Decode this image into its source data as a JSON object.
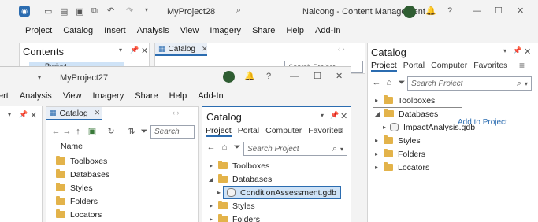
{
  "back_window": {
    "title": "MyProject28",
    "app_title": "Naicong - Content Management",
    "menu": [
      "Project",
      "Catalog",
      "Insert",
      "Analysis",
      "View",
      "Imagery",
      "Share",
      "Help",
      "Add-In"
    ],
    "contents_title": "Contents",
    "contents_item": "Project",
    "catalog_tab": "Catalog",
    "search_placeholder": "Search Project"
  },
  "front_window": {
    "title": "MyProject27",
    "menu": [
      "ert",
      "Analysis",
      "View",
      "Imagery",
      "Share",
      "Help",
      "Add-In"
    ],
    "catalog_tab": "Catalog",
    "search_placeholder": "Search",
    "name_header": "Name",
    "items": [
      "Toolboxes",
      "Databases",
      "Styles",
      "Folders",
      "Locators"
    ]
  },
  "front_catalog_pane": {
    "title": "Catalog",
    "tabs": [
      "Project",
      "Portal",
      "Computer",
      "Favorites"
    ],
    "search_placeholder": "Search Project",
    "tree": {
      "toolboxes": "Toolboxes",
      "databases": "Databases",
      "db_child": "ConditionAssessment.gdb",
      "styles": "Styles",
      "folders": "Folders"
    }
  },
  "right_catalog_pane": {
    "title": "Catalog",
    "tabs": [
      "Project",
      "Portal",
      "Computer",
      "Favorites"
    ],
    "search_placeholder": "Search Project",
    "tree": {
      "toolboxes": "Toolboxes",
      "databases": "Databases",
      "db_child": "ImpactAnalysis.gdb",
      "styles": "Styles",
      "folders": "Folders",
      "locators": "Locators"
    },
    "drag_tooltip": "Add to Project"
  },
  "colors": {
    "accent": "#2b6cb0",
    "folder": "#e3b34a",
    "selection": "#cfe3f7"
  }
}
